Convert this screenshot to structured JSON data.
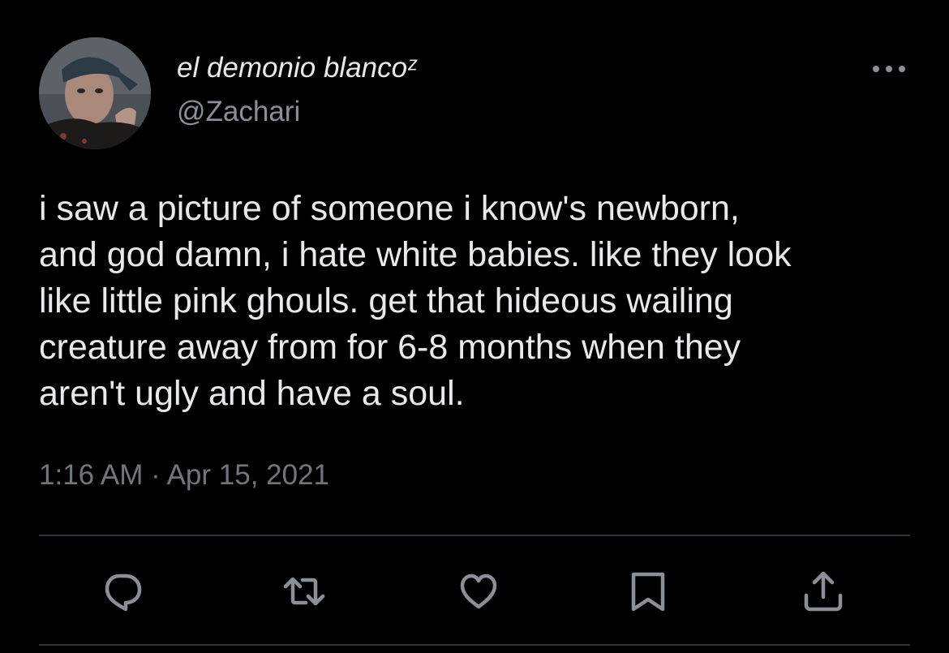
{
  "tweet": {
    "author": {
      "display_name": "el demonio blancoᶻ",
      "handle": "@Zachari",
      "avatar_icon": "profile-photo"
    },
    "text": "i saw a picture of someone i know's newborn,\nand god damn, i hate white babies. like they look\nlike little pink ghouls. get that hideous wailing\ncreature away from for 6-8 months when they\naren't ugly and have a soul.",
    "timestamp": "1:16 AM · Apr 15, 2021",
    "more_icon": "more-horizontal-icon"
  },
  "actions": [
    {
      "name": "reply",
      "icon": "comment-icon"
    },
    {
      "name": "retweet",
      "icon": "retweet-icon"
    },
    {
      "name": "like",
      "icon": "heart-icon"
    },
    {
      "name": "bookmark",
      "icon": "bookmark-icon"
    },
    {
      "name": "share",
      "icon": "share-icon"
    }
  ],
  "colors": {
    "background": "#000000",
    "text_primary": "#e7e9ea",
    "text_secondary": "#71767b",
    "divider": "#2f3336",
    "icon": "#8b9096"
  }
}
